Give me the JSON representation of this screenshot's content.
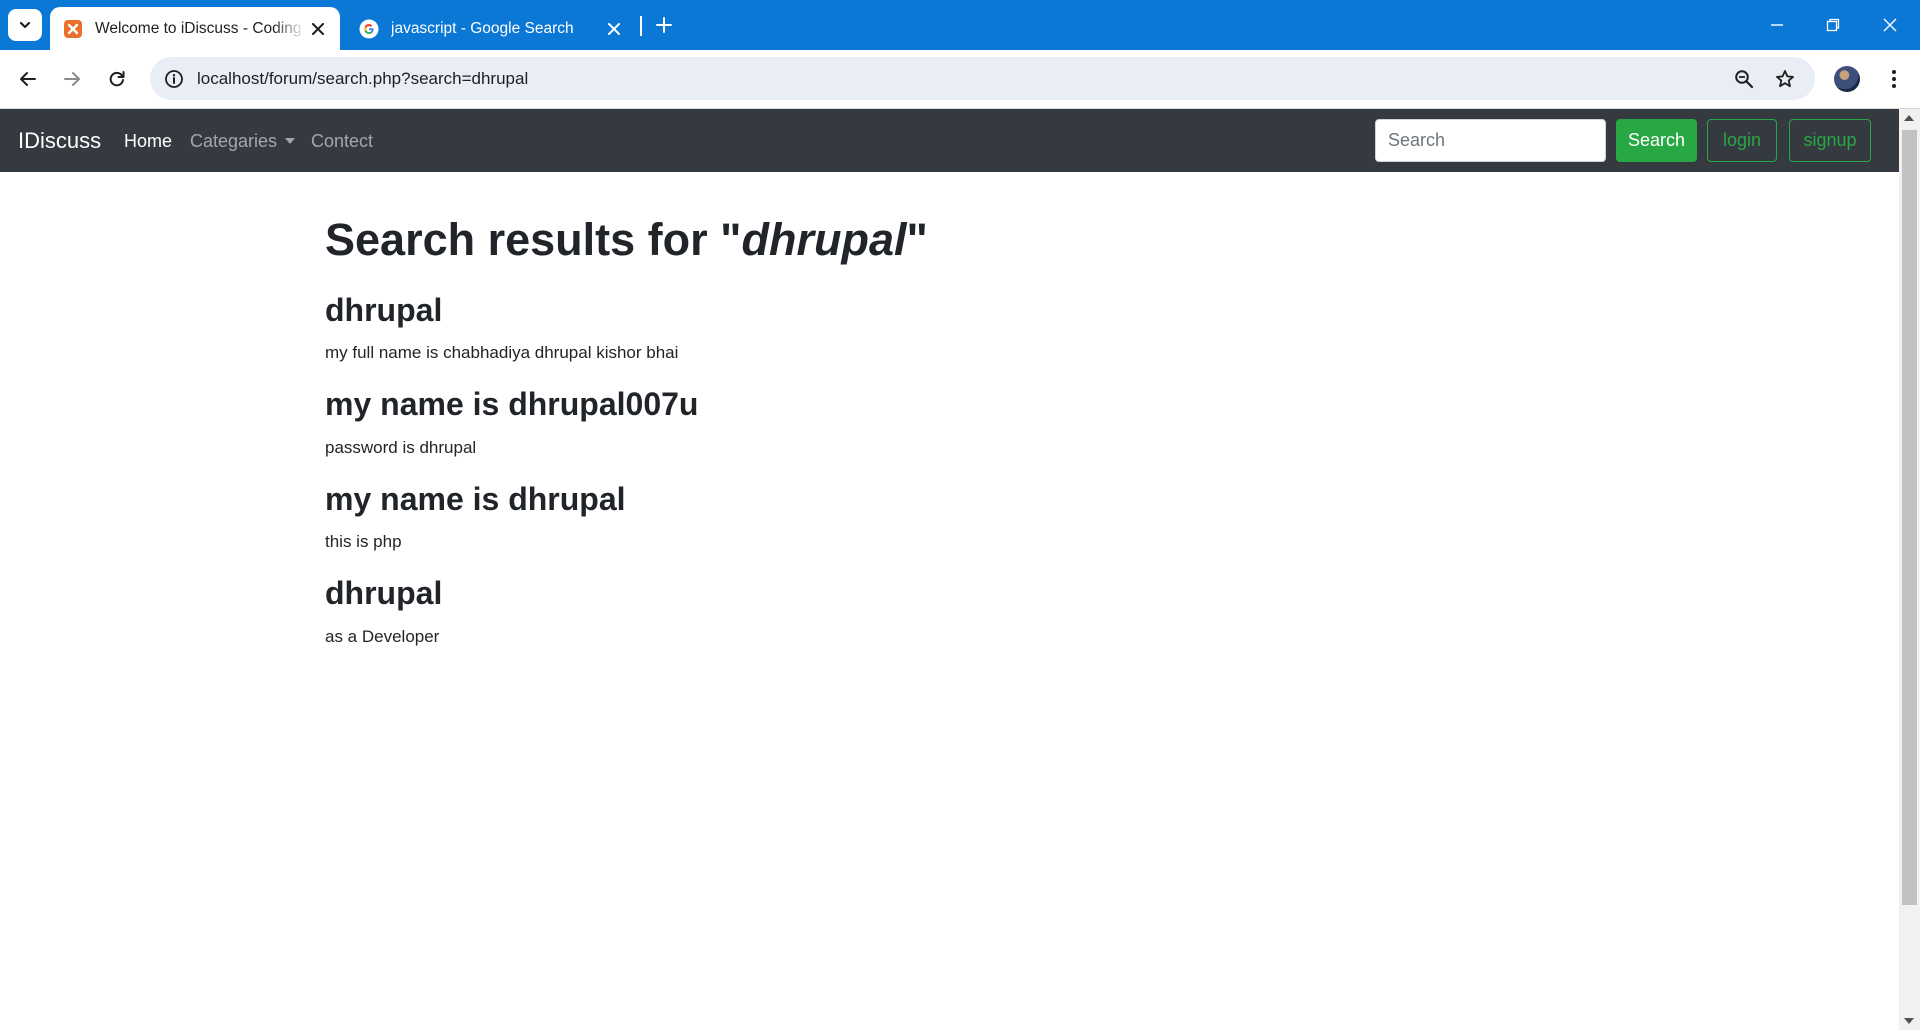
{
  "browser": {
    "tabs": [
      {
        "title": "Welcome to iDiscuss - Coding Forums",
        "active": true
      },
      {
        "title": "javascript - Google Search",
        "active": false
      }
    ],
    "url": "localhost/forum/search.php?search=dhrupal",
    "accent_color": "#0b78d6"
  },
  "navbar": {
    "brand": "IDiscuss",
    "links": [
      "Home",
      "Categaries",
      "Contect"
    ],
    "search_placeholder": "Search",
    "search_button": "Search",
    "login_button": "login",
    "signup_button": "signup"
  },
  "results": {
    "heading_prefix": "Search results for \"",
    "query": "dhrupal",
    "heading_suffix": "\"",
    "items": [
      {
        "title": "dhrupal",
        "description": "my full name is chabhadiya dhrupal kishor bhai"
      },
      {
        "title": "my name is dhrupal007u",
        "description": "password is dhrupal"
      },
      {
        "title": "my name is dhrupal",
        "description": "this is php"
      },
      {
        "title": "dhrupal",
        "description": "as a Developer"
      }
    ]
  }
}
